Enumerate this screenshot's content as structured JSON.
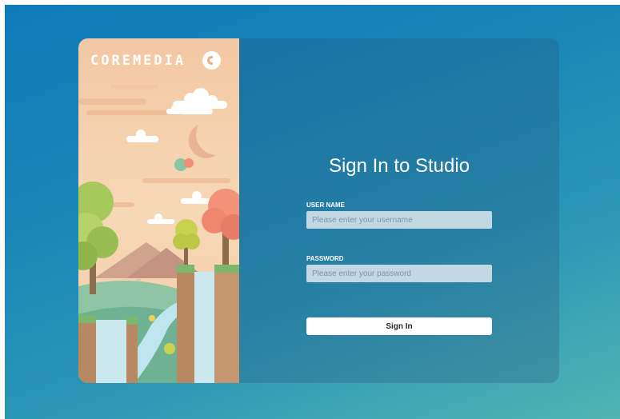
{
  "brand": {
    "name": "COREMEDIA"
  },
  "login": {
    "title": "Sign In to Studio",
    "username_label": "USER NAME",
    "username_placeholder": "Please enter your username",
    "username_value": "",
    "password_label": "PASSWORD",
    "password_placeholder": "Please enter your password",
    "password_value": "",
    "submit_label": "Sign In"
  },
  "colors": {
    "background_start": "#0e7ab8",
    "background_end": "#52b4b3",
    "input_fill": "#c2d8e3",
    "button_fill": "#ffffff",
    "sky": "#f7d8b6"
  },
  "icons": [
    "coremedia-logo-icon",
    "illustration-landscape"
  ]
}
